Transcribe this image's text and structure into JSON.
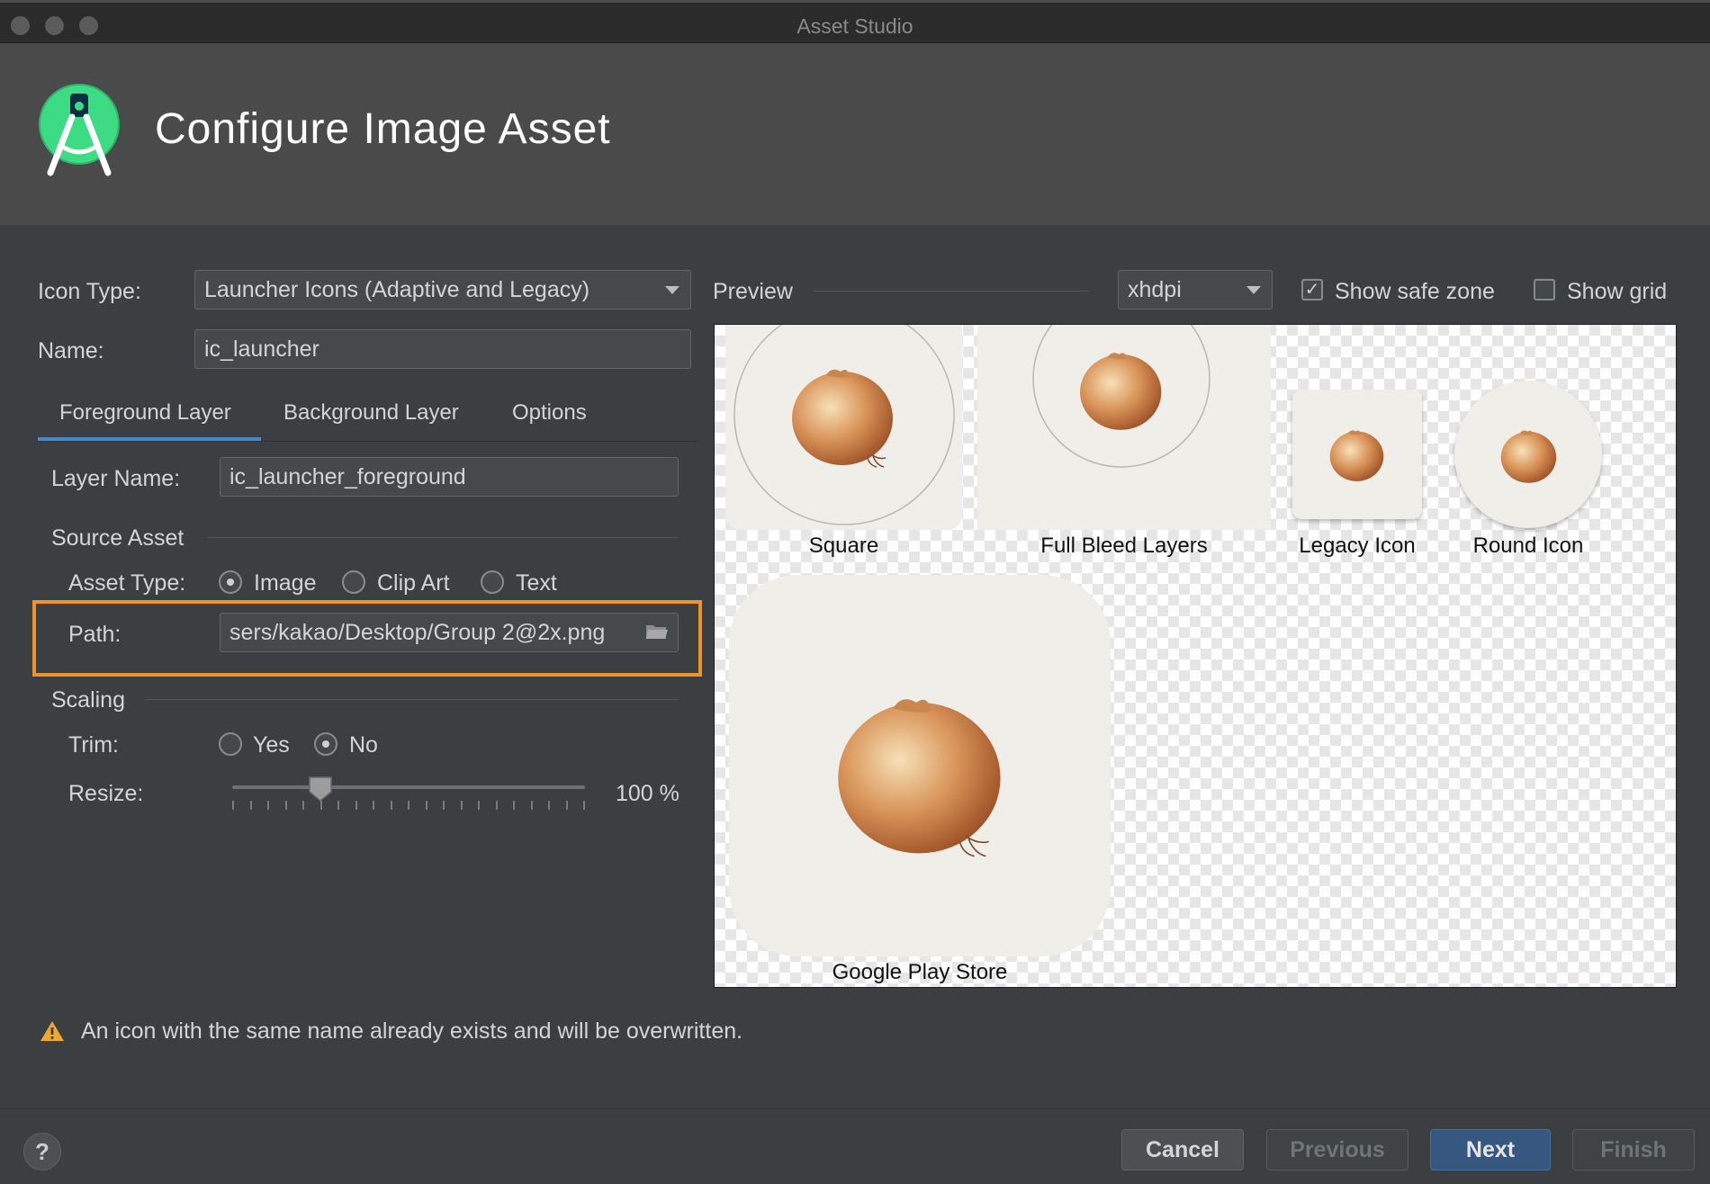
{
  "window": {
    "title": "Asset Studio"
  },
  "header": {
    "title": "Configure Image Asset",
    "logo_icon": "android-studio-logo"
  },
  "form": {
    "icon_type_label": "Icon Type:",
    "icon_type_value": "Launcher Icons (Adaptive and Legacy)",
    "name_label": "Name:",
    "name_value": "ic_launcher",
    "tabs": [
      {
        "label": "Foreground Layer",
        "active": true
      },
      {
        "label": "Background Layer",
        "active": false
      },
      {
        "label": "Options",
        "active": false
      }
    ],
    "layer_name_label": "Layer Name:",
    "layer_name_value": "ic_launcher_foreground",
    "source_asset_section": "Source Asset",
    "asset_type_label": "Asset Type:",
    "asset_type_options": [
      "Image",
      "Clip Art",
      "Text"
    ],
    "asset_type_selected": "Image",
    "path_label": "Path:",
    "path_value": "sers/kakao/Desktop/Group 2@2x.png",
    "scaling_section": "Scaling",
    "trim_label": "Trim:",
    "trim_options": [
      "Yes",
      "No"
    ],
    "trim_selected": "No",
    "resize_label": "Resize:",
    "resize_value": "100 %",
    "resize_fraction": 0.25
  },
  "preview": {
    "label": "Preview",
    "density_value": "xhdpi",
    "show_safe_zone_label": "Show safe zone",
    "show_safe_zone_checked": true,
    "show_grid_label": "Show grid",
    "show_grid_checked": false,
    "items": [
      "Square",
      "Full Bleed Layers",
      "Legacy Icon",
      "Round Icon",
      "Google Play Store"
    ]
  },
  "warning": {
    "text": "An icon with the same name already exists and will be overwritten.",
    "icon": "warning-icon"
  },
  "footer": {
    "help_label": "?",
    "cancel_label": "Cancel",
    "previous_label": "Previous",
    "next_label": "Next",
    "finish_label": "Finish"
  },
  "colors": {
    "accent": "#4a88c7",
    "highlight": "#f0932a",
    "primary_button": "#365880"
  }
}
